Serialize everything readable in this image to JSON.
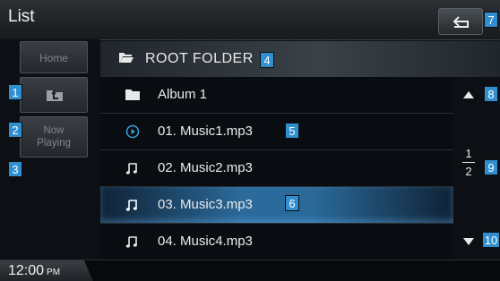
{
  "header": {
    "title": "List"
  },
  "folder": {
    "name": "ROOT FOLDER"
  },
  "sidebar": {
    "home_label": "Home",
    "now_playing_line1": "Now",
    "now_playing_line2": "Playing"
  },
  "list": {
    "items": [
      {
        "label": "Album 1",
        "icon": "folder-icon"
      },
      {
        "label": "01. Music1.mp3",
        "icon": "play-circle-icon"
      },
      {
        "label": "02. Music2.mp3",
        "icon": "music-note-icon"
      },
      {
        "label": "03. Music3.mp3",
        "icon": "music-note-icon",
        "selected": true
      },
      {
        "label": "04. Music4.mp3",
        "icon": "music-note-icon"
      }
    ]
  },
  "pagination": {
    "current": "1",
    "total": "2"
  },
  "status": {
    "time": "12:00",
    "ampm": "PM"
  },
  "callouts": [
    "1",
    "2",
    "3",
    "4",
    "5",
    "6",
    "7",
    "8",
    "9",
    "10"
  ],
  "colors": {
    "accent": "#2f8fd0",
    "selected_row": "#2b6a9a"
  }
}
